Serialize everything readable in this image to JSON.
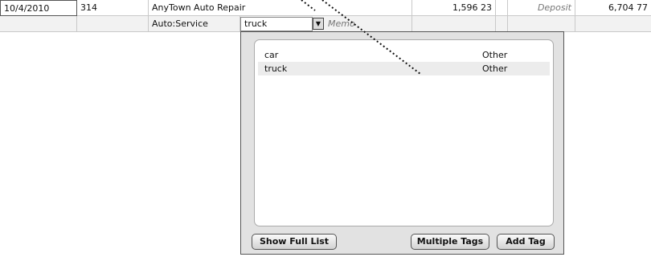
{
  "register": {
    "row1": {
      "date": "10/4/2010",
      "number": "314",
      "payee": "AnyTown Auto Repair",
      "payment": "1,596 23",
      "deposit": "Deposit",
      "balance": "6,704 77"
    },
    "row2": {
      "category": "Auto:Service",
      "tag_value": "truck",
      "memo_placeholder": "Memo"
    }
  },
  "tag_popup": {
    "items": [
      {
        "name": "car",
        "type": "Other"
      },
      {
        "name": "truck",
        "type": "Other"
      }
    ],
    "selected": "truck",
    "buttons": {
      "show_full_list": "Show Full List",
      "multiple_tags": "Multiple Tags",
      "add_tag": "Add Tag"
    }
  },
  "icons": {
    "dropdown": "dropdown-arrow-icon"
  }
}
